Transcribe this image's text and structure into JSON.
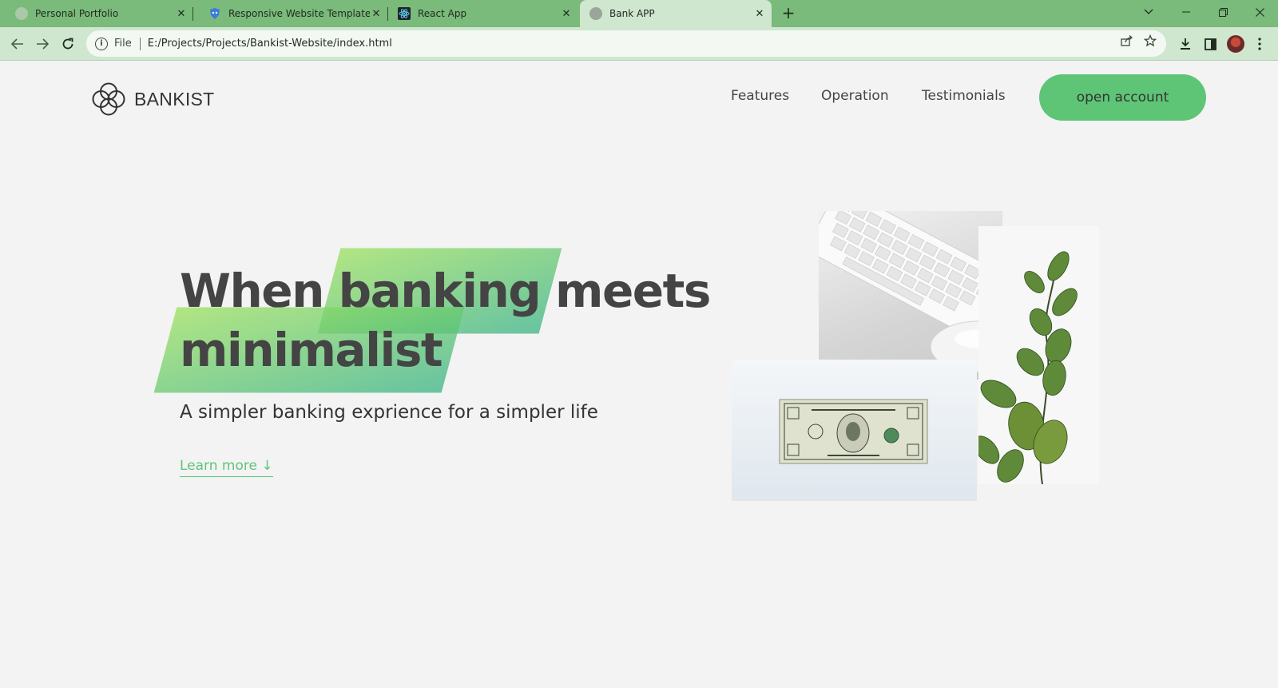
{
  "browser": {
    "tabs": [
      {
        "title": "Personal Portfolio",
        "active": false
      },
      {
        "title": "Responsive Website Template Ve",
        "active": false
      },
      {
        "title": "React App",
        "active": false
      },
      {
        "title": "Bank APP",
        "active": true
      }
    ],
    "close_glyph": "✕",
    "new_tab_glyph": "+",
    "address_bar": {
      "scheme_label": "File",
      "url": "E:/Projects/Projects/Bankist-Website/index.html"
    },
    "colors": {
      "tabbar": "#7aba7a",
      "toolbar": "#cfe6cf"
    }
  },
  "site": {
    "logo_text": "BANKIST",
    "nav": {
      "features": "Features",
      "operation": "Operation",
      "testimonials": "Testimonials",
      "cta": "open account"
    },
    "hero": {
      "title_word_1": "When",
      "title_highlight_1": "banking",
      "title_word_2": "meets",
      "title_highlight_2": "minimalist",
      "subtitle": "A simpler banking exprience for a simpler life",
      "learn_more": "Learn more ↓"
    },
    "colors": {
      "accent": "#5ec576",
      "highlight_from": "#39b385",
      "highlight_to": "#9be15d",
      "text": "#444444"
    }
  }
}
